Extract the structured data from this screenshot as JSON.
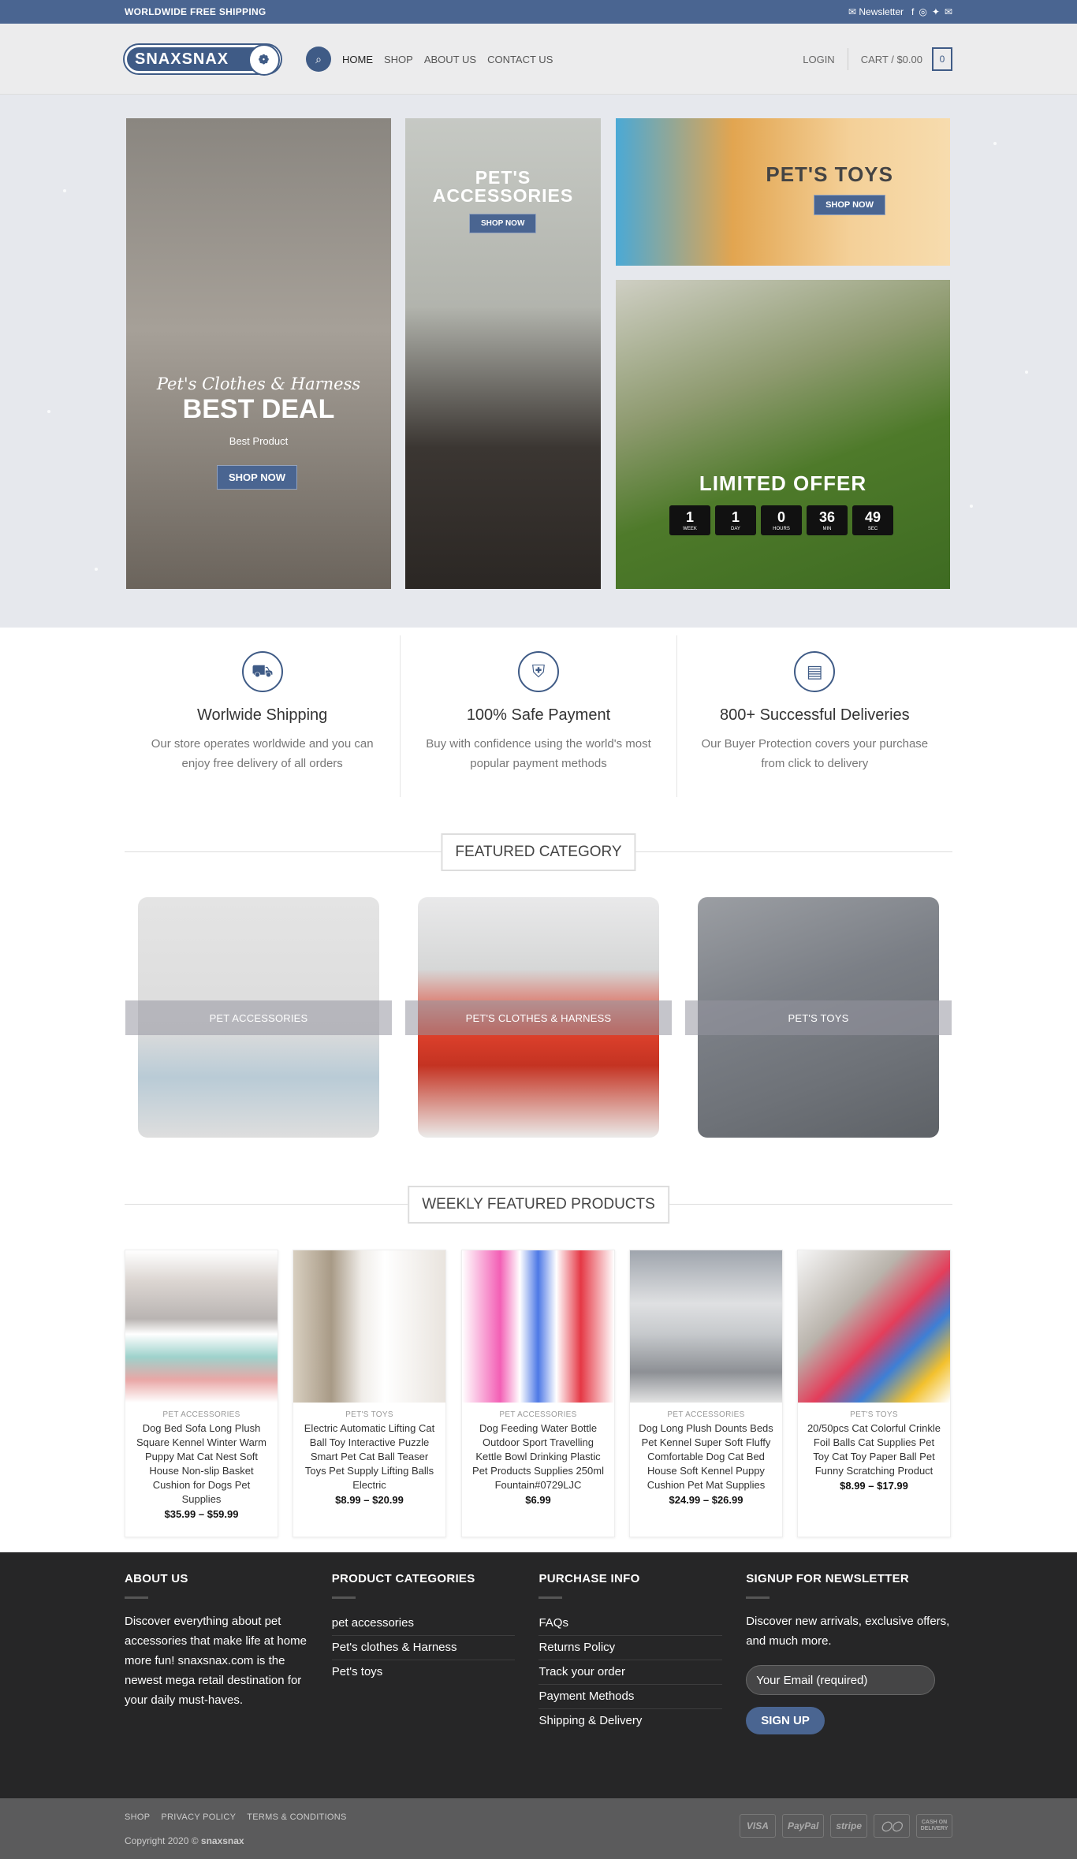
{
  "topbar": {
    "shipping": "WORLDWIDE FREE SHIPPING",
    "newsletter": "Newsletter",
    "social_icons": [
      "facebook-icon",
      "instagram-icon",
      "twitter-icon",
      "email-icon"
    ]
  },
  "header": {
    "logo": "SNAXSNAX",
    "nav": [
      "HOME",
      "SHOP",
      "ABOUT US",
      "CONTACT US"
    ],
    "login": "LOGIN",
    "cart": "CART / $0.00",
    "cart_count": "0"
  },
  "hero": {
    "b1": {
      "script": "Pet's Clothes & Harness",
      "title": "BEST DEAL",
      "subtitle": "Best Product",
      "button": "SHOP NOW"
    },
    "b2": {
      "title": "PET'S ACCESSORIES",
      "button": "SHOP NOW"
    },
    "b3": {
      "title": "PET'S TOYS",
      "button": "SHOP NOW"
    },
    "b4": {
      "title": "LIMITED OFFER",
      "countdown": [
        {
          "value": "1",
          "unit": "WEEK"
        },
        {
          "value": "1",
          "unit": "DAY"
        },
        {
          "value": "0",
          "unit": "HOURS"
        },
        {
          "value": "36",
          "unit": "MIN"
        },
        {
          "value": "49",
          "unit": "SEC"
        }
      ]
    }
  },
  "features": [
    {
      "icon": "delivery-truck-icon",
      "title": "Worlwide Shipping",
      "text": "Our store operates worldwide and you can enjoy free delivery of all orders"
    },
    {
      "icon": "secure-payment-icon",
      "title": "100% Safe Payment",
      "text": "Buy with confidence using the world's most popular payment methods"
    },
    {
      "icon": "invoice-icon",
      "title": "800+ Successful Deliveries",
      "text": "Our Buyer Protection covers your purchase from click to delivery"
    }
  ],
  "featured_category": {
    "title": "FEATURED CATEGORY",
    "items": [
      "PET ACCESSORIES",
      "PET'S CLOTHES & HARNESS",
      "PET'S TOYS"
    ]
  },
  "weekly": {
    "title": "WEEKLY FEATURED PRODUCTS",
    "products": [
      {
        "category": "PET ACCESSORIES",
        "name": "Dog Bed Sofa Long Plush Square Kennel Winter Warm Puppy Mat Cat Nest Soft House Non-slip Basket Cushion for Dogs Pet Supplies",
        "price": "$35.99 – $59.99"
      },
      {
        "category": "PET'S TOYS",
        "name": "Electric Automatic Lifting Cat Ball Toy Interactive Puzzle Smart Pet Cat Ball Teaser Toys Pet Supply Lifting Balls Electric",
        "price": "$8.99 – $20.99"
      },
      {
        "category": "PET ACCESSORIES",
        "name": "Dog Feeding Water Bottle Outdoor Sport Travelling Kettle Bowl Drinking Plastic Pet Products Supplies 250ml Fountain#0729LJC",
        "price": "$6.99"
      },
      {
        "category": "PET ACCESSORIES",
        "name": "Dog Long Plush Dounts Beds Pet Kennel Super Soft Fluffy Comfortable Dog Cat Bed House Soft Kennel Puppy Cushion Pet Mat Supplies",
        "price": "$24.99 – $26.99"
      },
      {
        "category": "PET'S TOYS",
        "name": "20/50pcs Cat Colorful Crinkle Foil Balls Cat Supplies Pet Toy Cat Toy Paper Ball Pet Funny Scratching Product",
        "price": "$8.99 – $17.99"
      }
    ]
  },
  "footer": {
    "about": {
      "title": "ABOUT US",
      "text": "Discover everything about pet accessories that make life at home more fun! snaxsnax.com is the newest mega retail destination for your daily must-haves."
    },
    "categories": {
      "title": "PRODUCT CATEGORIES",
      "links": [
        "pet accessories",
        "Pet's clothes & Harness",
        "Pet's toys"
      ]
    },
    "purchase": {
      "title": "PURCHASE INFO",
      "links": [
        "FAQs",
        "Returns Policy",
        "Track your order",
        "Payment Methods",
        "Shipping & Delivery"
      ]
    },
    "newsletter": {
      "title": "SIGNUP FOR NEWSLETTER",
      "text": "Discover new arrivals, exclusive offers, and much more.",
      "placeholder": "Your Email (required)",
      "button": "SIGN UP"
    }
  },
  "bottom": {
    "links": [
      "SHOP",
      "PRIVACY POLICY",
      "TERMS & CONDITIONS"
    ],
    "copyright_prefix": "Copyright 2020 ©",
    "copyright_brand": "snaxsnax",
    "payments": [
      "VISA",
      "PayPal",
      "stripe",
      "mastercard",
      "CASH ON DELIVERY"
    ]
  }
}
